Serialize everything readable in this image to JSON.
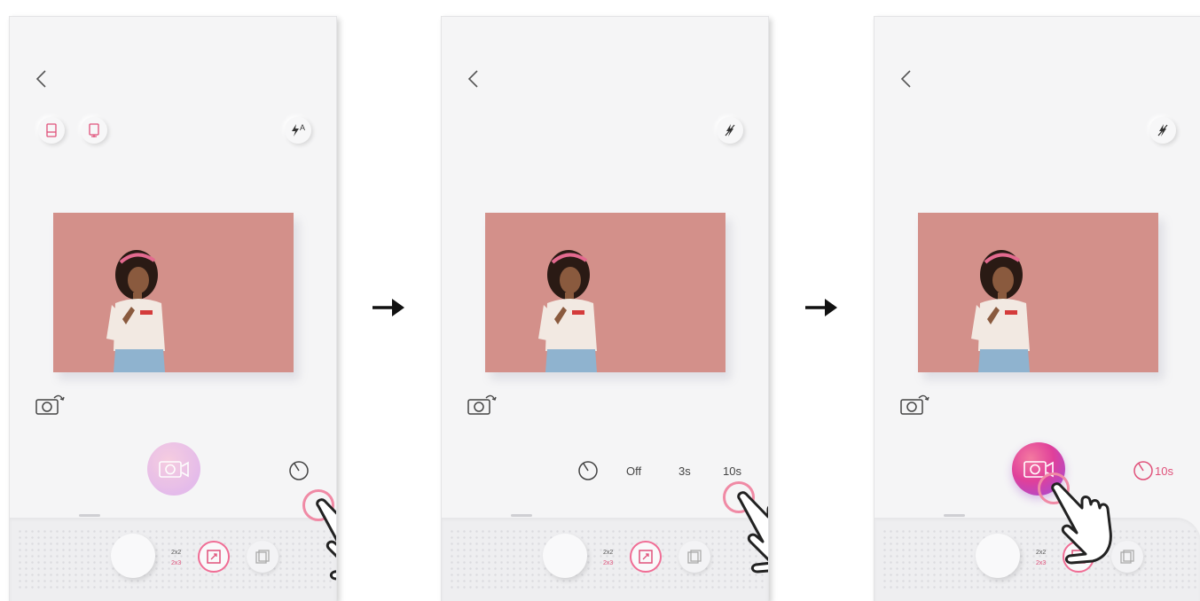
{
  "screens": [
    {
      "flash_label": "A",
      "timer": {
        "state": "collapsed"
      },
      "shutter": "inactive"
    },
    {
      "timer": {
        "state": "expanded",
        "options": [
          "Off",
          "3s",
          "10s"
        ]
      },
      "shutter": "inactive"
    },
    {
      "timer": {
        "state": "set",
        "value": "10s"
      },
      "shutter": "active"
    }
  ],
  "print_size": {
    "option_top": "2x2",
    "option_bottom": "2x3",
    "selected": "2x3"
  },
  "colors": {
    "accent_pink": "#e0517a",
    "photo_background": "#d3908a",
    "shutter_gradient_start": "#f47aa0",
    "shutter_gradient_end": "#9b4de0"
  },
  "icons": [
    "back-arrow",
    "single-print-mode",
    "collage-mode",
    "flash-auto",
    "flash-off",
    "switch-camera",
    "timer",
    "shutter-camera",
    "lens",
    "crop",
    "gallery",
    "pointing-hand",
    "right-arrow"
  ]
}
